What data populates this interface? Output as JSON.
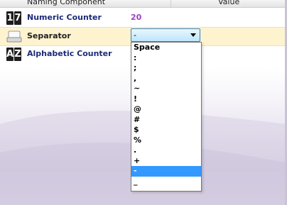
{
  "header": {
    "col1": "Naming Component",
    "col2": "Value"
  },
  "rows": [
    {
      "icon": "numeric-counter-icon",
      "icon_chars": [
        "1",
        "7"
      ],
      "label": "Numeric Counter",
      "value": "20"
    },
    {
      "icon": "separator-icon",
      "label": "Separator",
      "value": "-"
    },
    {
      "icon": "alphabetic-counter-icon",
      "icon_chars": [
        "A",
        "Z"
      ],
      "label": "Alphabetic Counter",
      "value": ""
    }
  ],
  "dropdown": {
    "selected": "-",
    "options": [
      "Space",
      ":",
      ";",
      ",",
      "~",
      "!",
      "@",
      "#",
      "$",
      "%",
      ".",
      "+",
      "-",
      "_"
    ]
  },
  "colors": {
    "accent": "#3399ff",
    "value": "#9b3fc2",
    "label": "#1b2a78",
    "selected_row": "#fdf3cf"
  }
}
